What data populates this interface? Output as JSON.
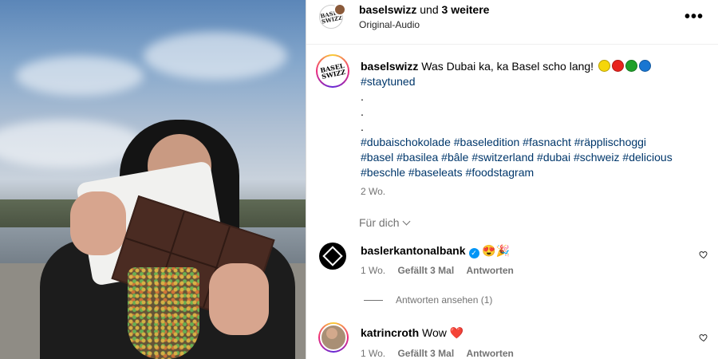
{
  "header": {
    "username": "baselswizz",
    "and_text": " und ",
    "others": "3 weitere",
    "audio": "Original-Audio",
    "more": "•••"
  },
  "logo": {
    "line1": "BASEL",
    "line2": "SWIZZ"
  },
  "caption": {
    "username": "baselswizz",
    "text": " Was Dubai ka, ka Basel scho lang!",
    "dots": [
      "#f5d60a",
      "#e8231d",
      "#1fa02a",
      "#1876d2"
    ],
    "hashtag_first": "#staytuned",
    "spacer_lines": [
      ".",
      ".",
      "."
    ],
    "hashtags_line1": "#dubaischokolade #baseledition #fasnacht #räpplischoggi",
    "hashtags_line2": "#basel #basilea #bâle #switzerland #dubai #schweiz #delicious",
    "hashtags_line3": "#beschle #baseleats #foodstagram",
    "time": "2 Wo."
  },
  "for_you": "Für dich",
  "comments": [
    {
      "username": "baslerkantonalbank",
      "text": "😍🎉",
      "time": "1 Wo.",
      "likes": "Gefällt 3 Mal",
      "reply": "Antworten",
      "view_replies": "Antworten ansehen (1)"
    },
    {
      "username": "katrincroth",
      "text": " Wow ❤️",
      "time": "1 Wo.",
      "likes": "Gefällt 3 Mal",
      "reply": "Antworten"
    }
  ],
  "icons": {
    "more": "more-options-icon",
    "heart": "heart-outline-icon",
    "chevron": "chevron-down-icon",
    "verified": "verified-badge-icon"
  }
}
